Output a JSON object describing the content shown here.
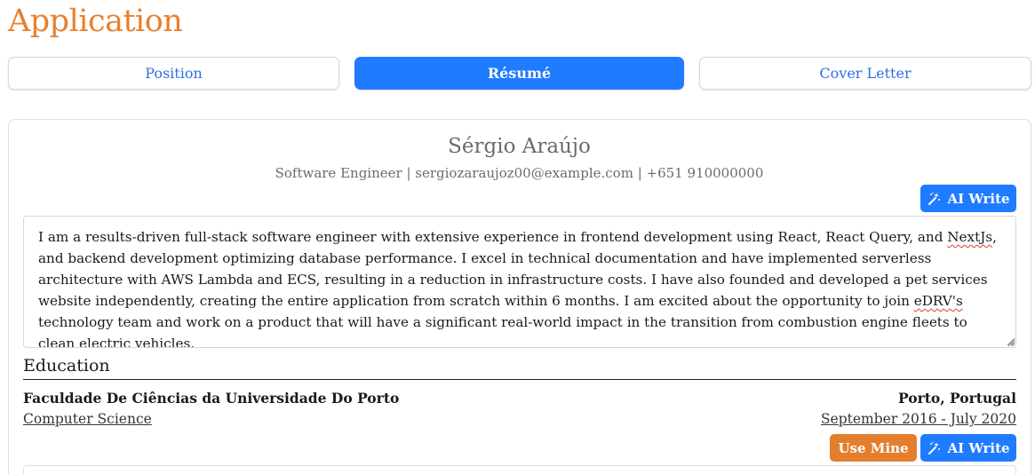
{
  "app": {
    "title": "Application"
  },
  "tabs": [
    {
      "label": "Position",
      "active": false
    },
    {
      "label": "Résumé",
      "active": true
    },
    {
      "label": "Cover Letter",
      "active": false
    }
  ],
  "resume": {
    "name": "Sérgio Araújo",
    "contact": "Software Engineer | sergiozaraujoz00@example.com | +651 910000000",
    "ai_write_label": "AI Write",
    "summary_parts": [
      "I am a results-driven full-stack software engineer with extensive experience in frontend development using React, React Query, and ",
      "NextJs",
      ", and backend development optimizing database performance. I excel in technical documentation and have implemented serverless architecture with AWS Lambda and ECS, resulting in a reduction in infrastructure costs. I have also founded and developed a pet services website independently, creating the entire application from scratch within 6 months. I am excited about the opportunity to join ",
      "eDRV's",
      " technology team and work on a product that will have a significant real-world impact in the transition from combustion engine fleets to clean electric vehicles."
    ]
  },
  "education": {
    "section_title": "Education",
    "entries": [
      {
        "school": "Faculdade De Ciências da Universidade Do Porto",
        "location": "Porto, Portugal",
        "field": "Computer Science",
        "dates": "September 2016 - July 2020",
        "use_mine_label": "Use Mine",
        "ai_write_label": "AI Write"
      }
    ]
  },
  "colors": {
    "accent_orange": "#e8802f",
    "primary_blue": "#1f7bff",
    "tab_text_blue": "#2f6fe6",
    "button_orange": "#e47e2c"
  },
  "icons": {
    "ai_write": "magic-wand-icon",
    "resize": "resize-grip-icon"
  }
}
